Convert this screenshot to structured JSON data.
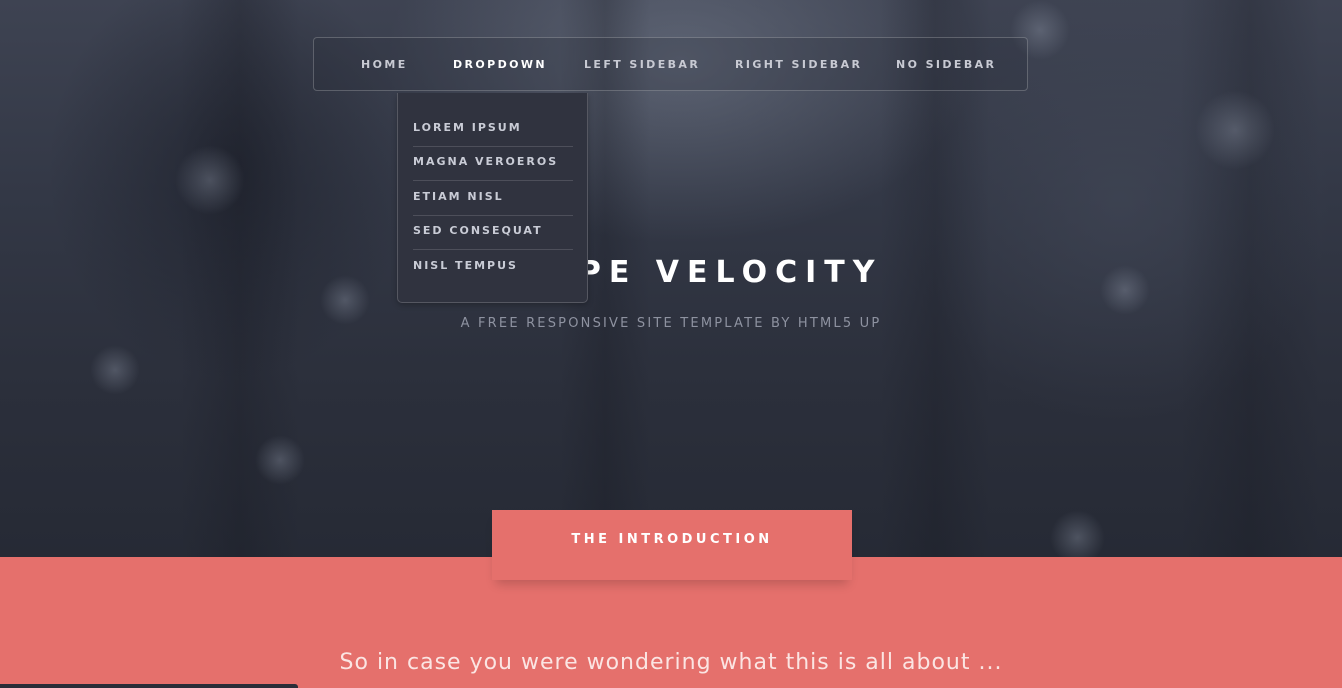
{
  "nav": {
    "items": [
      {
        "label": "HOME"
      },
      {
        "label": "DROPDOWN"
      },
      {
        "label": "LEFT SIDEBAR"
      },
      {
        "label": "RIGHT SIDEBAR"
      },
      {
        "label": "NO SIDEBAR"
      }
    ]
  },
  "dropdown": {
    "items": [
      {
        "label": "LOREM IPSUM"
      },
      {
        "label": "MAGNA VEROEROS"
      },
      {
        "label": "ETIAM NISL"
      },
      {
        "label": "SED CONSEQUAT"
      },
      {
        "label": "NISL TEMPUS"
      }
    ]
  },
  "hero": {
    "title": "ESCAPE VELOCITY",
    "tagline": "A FREE RESPONSIVE SITE TEMPLATE BY HTML5 UP"
  },
  "intro": {
    "tab_label": "THE INTRODUCTION",
    "headline": "So in case you were wondering what this is all about ..."
  },
  "colors": {
    "accent": "#e5706c",
    "header_dark": "#2b2f3b",
    "dropdown_bg": "#30333f"
  }
}
